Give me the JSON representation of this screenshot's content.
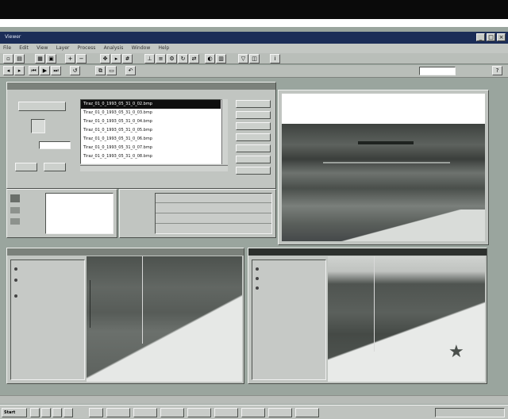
{
  "app": {
    "title": "Viewer"
  },
  "menu": [
    "File",
    "Edit",
    "View",
    "Layer",
    "Process",
    "Analysis",
    "Window",
    "Help"
  ],
  "toolbar_icons": [
    "new-icon",
    "open-icon",
    "save-icon",
    "print-icon",
    "zoom-in-icon",
    "zoom-out-icon",
    "pan-icon",
    "select-icon",
    "grid-icon",
    "measure-icon",
    "layers-icon",
    "settings-icon"
  ],
  "zoom_field": {
    "value": ""
  },
  "file_list": {
    "items": [
      "Tiraz_01_0_1993_05_31_0_02.bmp",
      "Tiraz_01_0_1993_05_31_0_03.bmp",
      "Tiraz_01_0_1993_05_31_0_04.bmp",
      "Tiraz_01_0_1993_05_31_0_05.bmp",
      "Tiraz_01_0_1993_05_31_0_06.bmp",
      "Tiraz_01_0_1993_05_31_0_07.bmp",
      "Tiraz_01_0_1993_05_31_0_08.bmp"
    ],
    "selected_index": 0
  },
  "left_controls": {
    "top_button": "",
    "value_field": "",
    "button_a": "",
    "button_b": ""
  },
  "right_buttons": [
    "",
    "",
    "",
    "",
    "",
    "",
    ""
  ],
  "table_rows": [
    [
      "",
      "",
      "",
      ""
    ],
    [
      "",
      "",
      "",
      ""
    ],
    [
      "",
      "",
      "",
      ""
    ],
    [
      "",
      "",
      "",
      ""
    ]
  ],
  "lower_left_panel": {
    "title": "",
    "options": [
      "",
      "",
      ""
    ]
  },
  "lower_right_panel": {
    "title": "",
    "options": [
      "",
      "",
      ""
    ]
  },
  "taskbar": {
    "start_label": "Start",
    "tasks": [
      "",
      "",
      "",
      "",
      "",
      "",
      "",
      "",
      ""
    ],
    "clock": ""
  },
  "colors": {
    "title_bar": "#1b2d57",
    "desktop": "#9aa59e",
    "face": "#c1c5c1"
  }
}
